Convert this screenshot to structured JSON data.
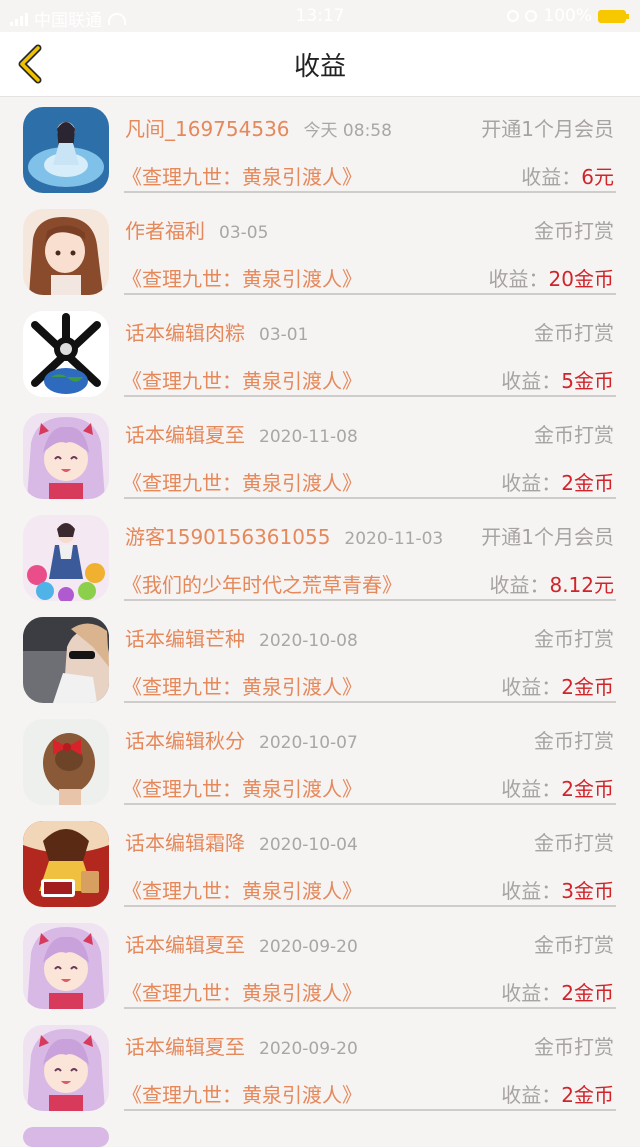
{
  "status_bar": {
    "carrier": "中国联通",
    "time": "13:17",
    "battery": "100%"
  },
  "header": {
    "title": "收益"
  },
  "records": [
    {
      "user": "凡间_169754536",
      "date": "今天 08:58",
      "type": "开通1个月会员",
      "book": "《查理九世：黄泉引渡人》",
      "income_label": "收益：",
      "income": "6元",
      "avatar": "blue-dress-girl"
    },
    {
      "user": "作者福利",
      "date": "03-05",
      "type": "金币打赏",
      "book": "《查理九世：黄泉引渡人》",
      "income_label": "收益：",
      "income": "20金币",
      "avatar": "anime-girl-brown-hair"
    },
    {
      "user": "话本编辑肉粽",
      "date": "03-01",
      "type": "金币打赏",
      "book": "《查理九世：黄泉引渡人》",
      "income_label": "收益：",
      "income": "5金币",
      "avatar": "bones-earth"
    },
    {
      "user": "话本编辑夏至",
      "date": "2020-11-08",
      "type": "金币打赏",
      "book": "《查理九世：黄泉引渡人》",
      "income_label": "收益：",
      "income": "2金币",
      "avatar": "anime-pink-girl"
    },
    {
      "user": "游客1590156361055",
      "date": "2020-11-03",
      "type": "开通1个月会员",
      "book": "《我们的少年时代之荒草青春》",
      "income_label": "收益：",
      "income": "8.12元",
      "avatar": "flower-doll"
    },
    {
      "user": "话本编辑芒种",
      "date": "2020-10-08",
      "type": "金币打赏",
      "book": "《查理九世：黄泉引渡人》",
      "income_label": "收益：",
      "income": "2金币",
      "avatar": "sunglasses-girl"
    },
    {
      "user": "话本编辑秋分",
      "date": "2020-10-07",
      "type": "金币打赏",
      "book": "《查理九世：黄泉引渡人》",
      "income_label": "收益：",
      "income": "2金币",
      "avatar": "hair-bow"
    },
    {
      "user": "话本编辑霜降",
      "date": "2020-10-04",
      "type": "金币打赏",
      "book": "《查理九世：黄泉引渡人》",
      "income_label": "收益：",
      "income": "3金币",
      "avatar": "cartoon-badge"
    },
    {
      "user": "话本编辑夏至",
      "date": "2020-09-20",
      "type": "金币打赏",
      "book": "《查理九世：黄泉引渡人》",
      "income_label": "收益：",
      "income": "2金币",
      "avatar": "anime-pink-girl"
    },
    {
      "user": "话本编辑夏至",
      "date": "2020-09-20",
      "type": "金币打赏",
      "book": "《查理九世：黄泉引渡人》",
      "income_label": "收益：",
      "income": "2金币",
      "avatar": "anime-pink-girl"
    }
  ]
}
